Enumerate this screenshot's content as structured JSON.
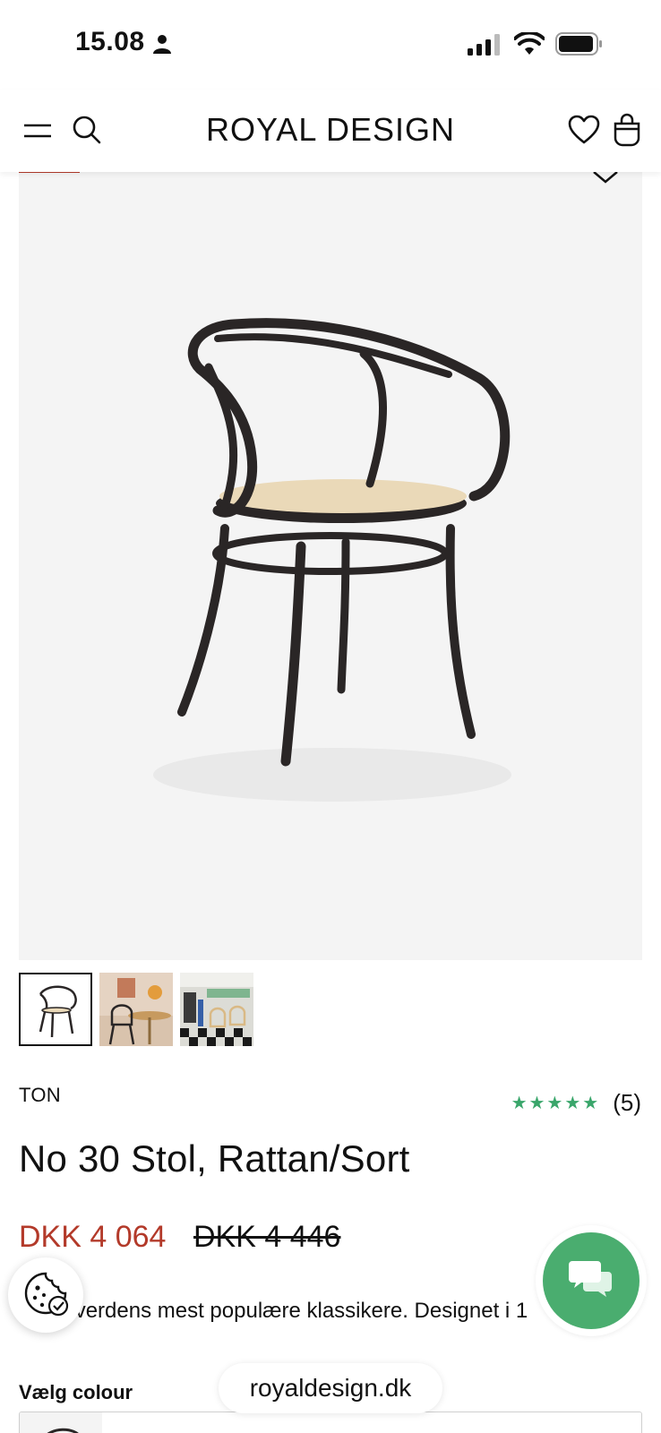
{
  "status_bar": {
    "time": "15.08",
    "icons": [
      "person-icon",
      "cellular-signal-icon",
      "wifi-icon",
      "battery-icon"
    ]
  },
  "header": {
    "logo": "ROYAL DESIGN",
    "icons": [
      "menu-icon",
      "search-icon",
      "heart-icon",
      "shopping-bag-icon"
    ]
  },
  "gallery": {
    "thumbnail_count": 3,
    "active_index": 0
  },
  "product": {
    "brand": "TON",
    "rating_stars": "★★★★★",
    "rating": 5,
    "review_count": "(5)",
    "title": "No 30 Stol, Rattan/Sort",
    "price_sale": "DKK 4 064",
    "price_original": "DKK 4 446",
    "description": "En af verdens mest populære klassikere. Designet i 1"
  },
  "variant": {
    "label": "Vælg colour"
  },
  "browser": {
    "url": "royaldesign.dk"
  },
  "colors": {
    "sale_price": "#b33a2a",
    "stars": "#3aa66b",
    "chat_button": "#4aad6f"
  }
}
